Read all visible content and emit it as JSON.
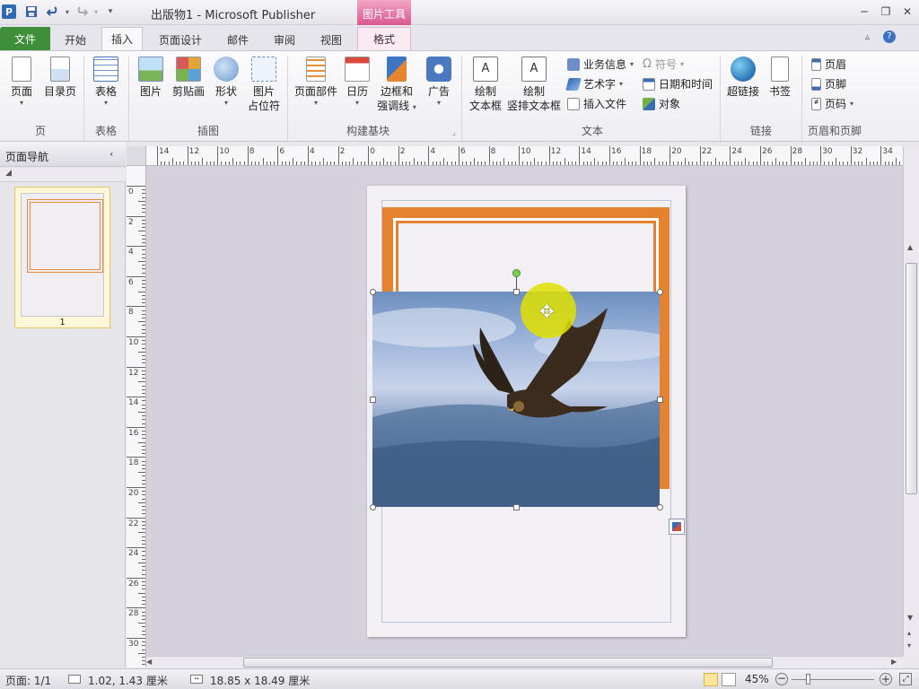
{
  "app": {
    "title": "出版物1  -  Microsoft Publisher",
    "context_tab_group": "图片工具"
  },
  "tabs": [
    {
      "label": "文件"
    },
    {
      "label": "开始"
    },
    {
      "label": "插入"
    },
    {
      "label": "页面设计"
    },
    {
      "label": "邮件"
    },
    {
      "label": "审阅"
    },
    {
      "label": "视图"
    },
    {
      "label": "格式"
    }
  ],
  "ribbon": {
    "page": {
      "label": "页面",
      "group": "页"
    },
    "catalog_page": {
      "label": "目录页"
    },
    "table": {
      "label": "表格",
      "group": "表格"
    },
    "picture": {
      "label": "图片"
    },
    "clipart": {
      "label": "剪贴画"
    },
    "shapes": {
      "label": "形状"
    },
    "picture_placeholder": {
      "label1": "图片",
      "label2": "占位符"
    },
    "illustrations_group": "插图",
    "page_parts": {
      "label": "页面部件"
    },
    "calendar": {
      "label": "日历"
    },
    "borders": {
      "label1": "边框和",
      "label2": "强调线"
    },
    "ads": {
      "label": "广告"
    },
    "building_blocks_group": "构建基块",
    "draw_textbox": {
      "label1": "绘制",
      "label2": "文本框"
    },
    "draw_vertical_textbox": {
      "label1": "绘制",
      "label2": "竖排文本框"
    },
    "business_info": "业务信息",
    "wordart": "艺术字",
    "insert_file": "插入文件",
    "symbol": "符号",
    "datetime": "日期和时间",
    "object": "对象",
    "text_group": "文本",
    "hyperlink": {
      "label": "超链接"
    },
    "bookmark": {
      "label": "书签"
    },
    "links_group": "链接",
    "header": "页眉",
    "footer": "页脚",
    "page_number": "页码",
    "header_footer_group": "页眉和页脚"
  },
  "navpane": {
    "title": "页面导航",
    "pages": [
      {
        "number": "1"
      }
    ]
  },
  "rulers": {
    "horizontal": [
      "14",
      "12",
      "10",
      "8",
      "6",
      "4",
      "2",
      "0",
      "2",
      "4",
      "6",
      "8",
      "10",
      "12",
      "14",
      "16",
      "18",
      "20",
      "22",
      "24",
      "26",
      "28",
      "30",
      "32",
      "34"
    ],
    "vertical": [
      "0",
      "2",
      "4",
      "6",
      "8",
      "10",
      "12",
      "14",
      "16",
      "18",
      "20",
      "22",
      "24",
      "26",
      "28",
      "30"
    ]
  },
  "statusbar": {
    "page": "页面: 1/1",
    "position": "1.02, 1.43 厘米",
    "size": "18.85 x  18.49 厘米",
    "zoom": "45%"
  },
  "colors": {
    "file_tab": "#3f8e3a",
    "context_tab": "#d9578e",
    "border_orange": "#e88a3a",
    "cursor_highlight": "#e0e000"
  },
  "icons": {
    "cursor": "move-cursor-icon",
    "rotate": "rotate-handle-icon"
  }
}
